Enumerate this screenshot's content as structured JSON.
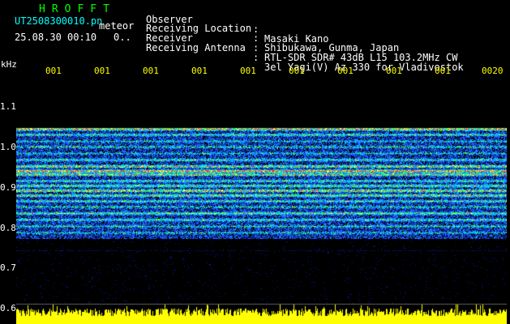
{
  "header": {
    "app_title": "HROFFT",
    "filename": "UT2508300010.pn",
    "meteor_label": "meteor",
    "datetime": "25.08.30 00:10",
    "counter": "0.."
  },
  "station_info": [
    {
      "label": "Observer",
      "value": "Masaki Kano"
    },
    {
      "label": "Receiving Location",
      "value": "Shibukawa, Gunma, Japan"
    },
    {
      "label": "Receiver",
      "value": "RTL-SDR SDR# 43dB L15 103.2MHz CW"
    },
    {
      "label": "Receiving Antenna",
      "value": "3el Yagi(V) Az 330 for Vladivostok"
    }
  ],
  "axis": {
    "freq_unit": "kHz",
    "freq_ticks": [
      "1.1",
      "1.0",
      "0.9",
      "0.8",
      "0.7",
      "0.6"
    ],
    "time_ticks": [
      "001",
      "001",
      "001",
      "001",
      "001",
      "001",
      "001",
      "001",
      "001",
      "0020"
    ]
  },
  "colors": {
    "title": "#00ff00",
    "info": "#ffffff",
    "filename": "#00ffff",
    "axis_time": "#ffff00",
    "noise_floor": "#ffff00",
    "background": "#000000"
  }
}
